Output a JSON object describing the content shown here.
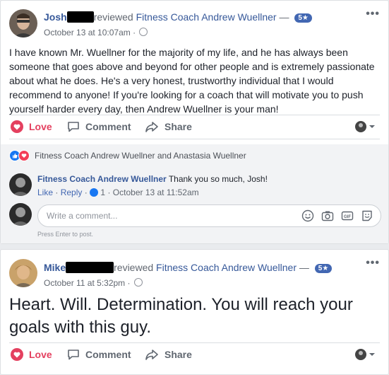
{
  "post1": {
    "author": "Josh",
    "verb": "reviewed",
    "page": "Fitness Coach Andrew Wuellner",
    "dash": "—",
    "rating": "5★",
    "time": "October 13 at 10:07am",
    "dot": "·",
    "text": "I have known Mr. Wuellner for the majority of my life, and he has always been someone that goes above and beyond for other people and is extremely passionate about what he does. He's a very honest, trustworthy individual that I would recommend to anyone! If you're looking for a coach that will motivate you to push yourself harder every day, then Andrew Wuellner is your man!",
    "reactions": "Fitness Coach Andrew Wuellner and Anastasia Wuellner",
    "comment": {
      "author": "Fitness Coach Andrew Wuellner",
      "text": "Thank you so much, Josh!",
      "like": "Like",
      "reply": "Reply",
      "likes": "1",
      "time": "October 13 at 11:52am",
      "sep": "·"
    },
    "write_placeholder": "Write a comment...",
    "hint": "Press Enter to post."
  },
  "post2": {
    "author": "Mike",
    "verb": "reviewed",
    "page": "Fitness Coach Andrew Wuellner",
    "dash": "—",
    "rating": "5★",
    "time": "October 11 at 5:32pm",
    "dot": "·",
    "text": "Heart. Will. Determination. You will reach your goals with this guy."
  },
  "actions": {
    "love": "Love",
    "comment": "Comment",
    "share": "Share"
  },
  "more": "•••",
  "colors": {
    "link": "#365899",
    "love": "#e4405f",
    "badge": "#4267b2",
    "background": "#e9ebee"
  },
  "icons": [
    "heart-icon",
    "comment-icon",
    "share-icon",
    "globe-icon",
    "like-reaction-icon",
    "love-reaction-icon",
    "emoji-icon",
    "camera-icon",
    "gif-icon",
    "sticker-icon",
    "more-icon"
  ]
}
